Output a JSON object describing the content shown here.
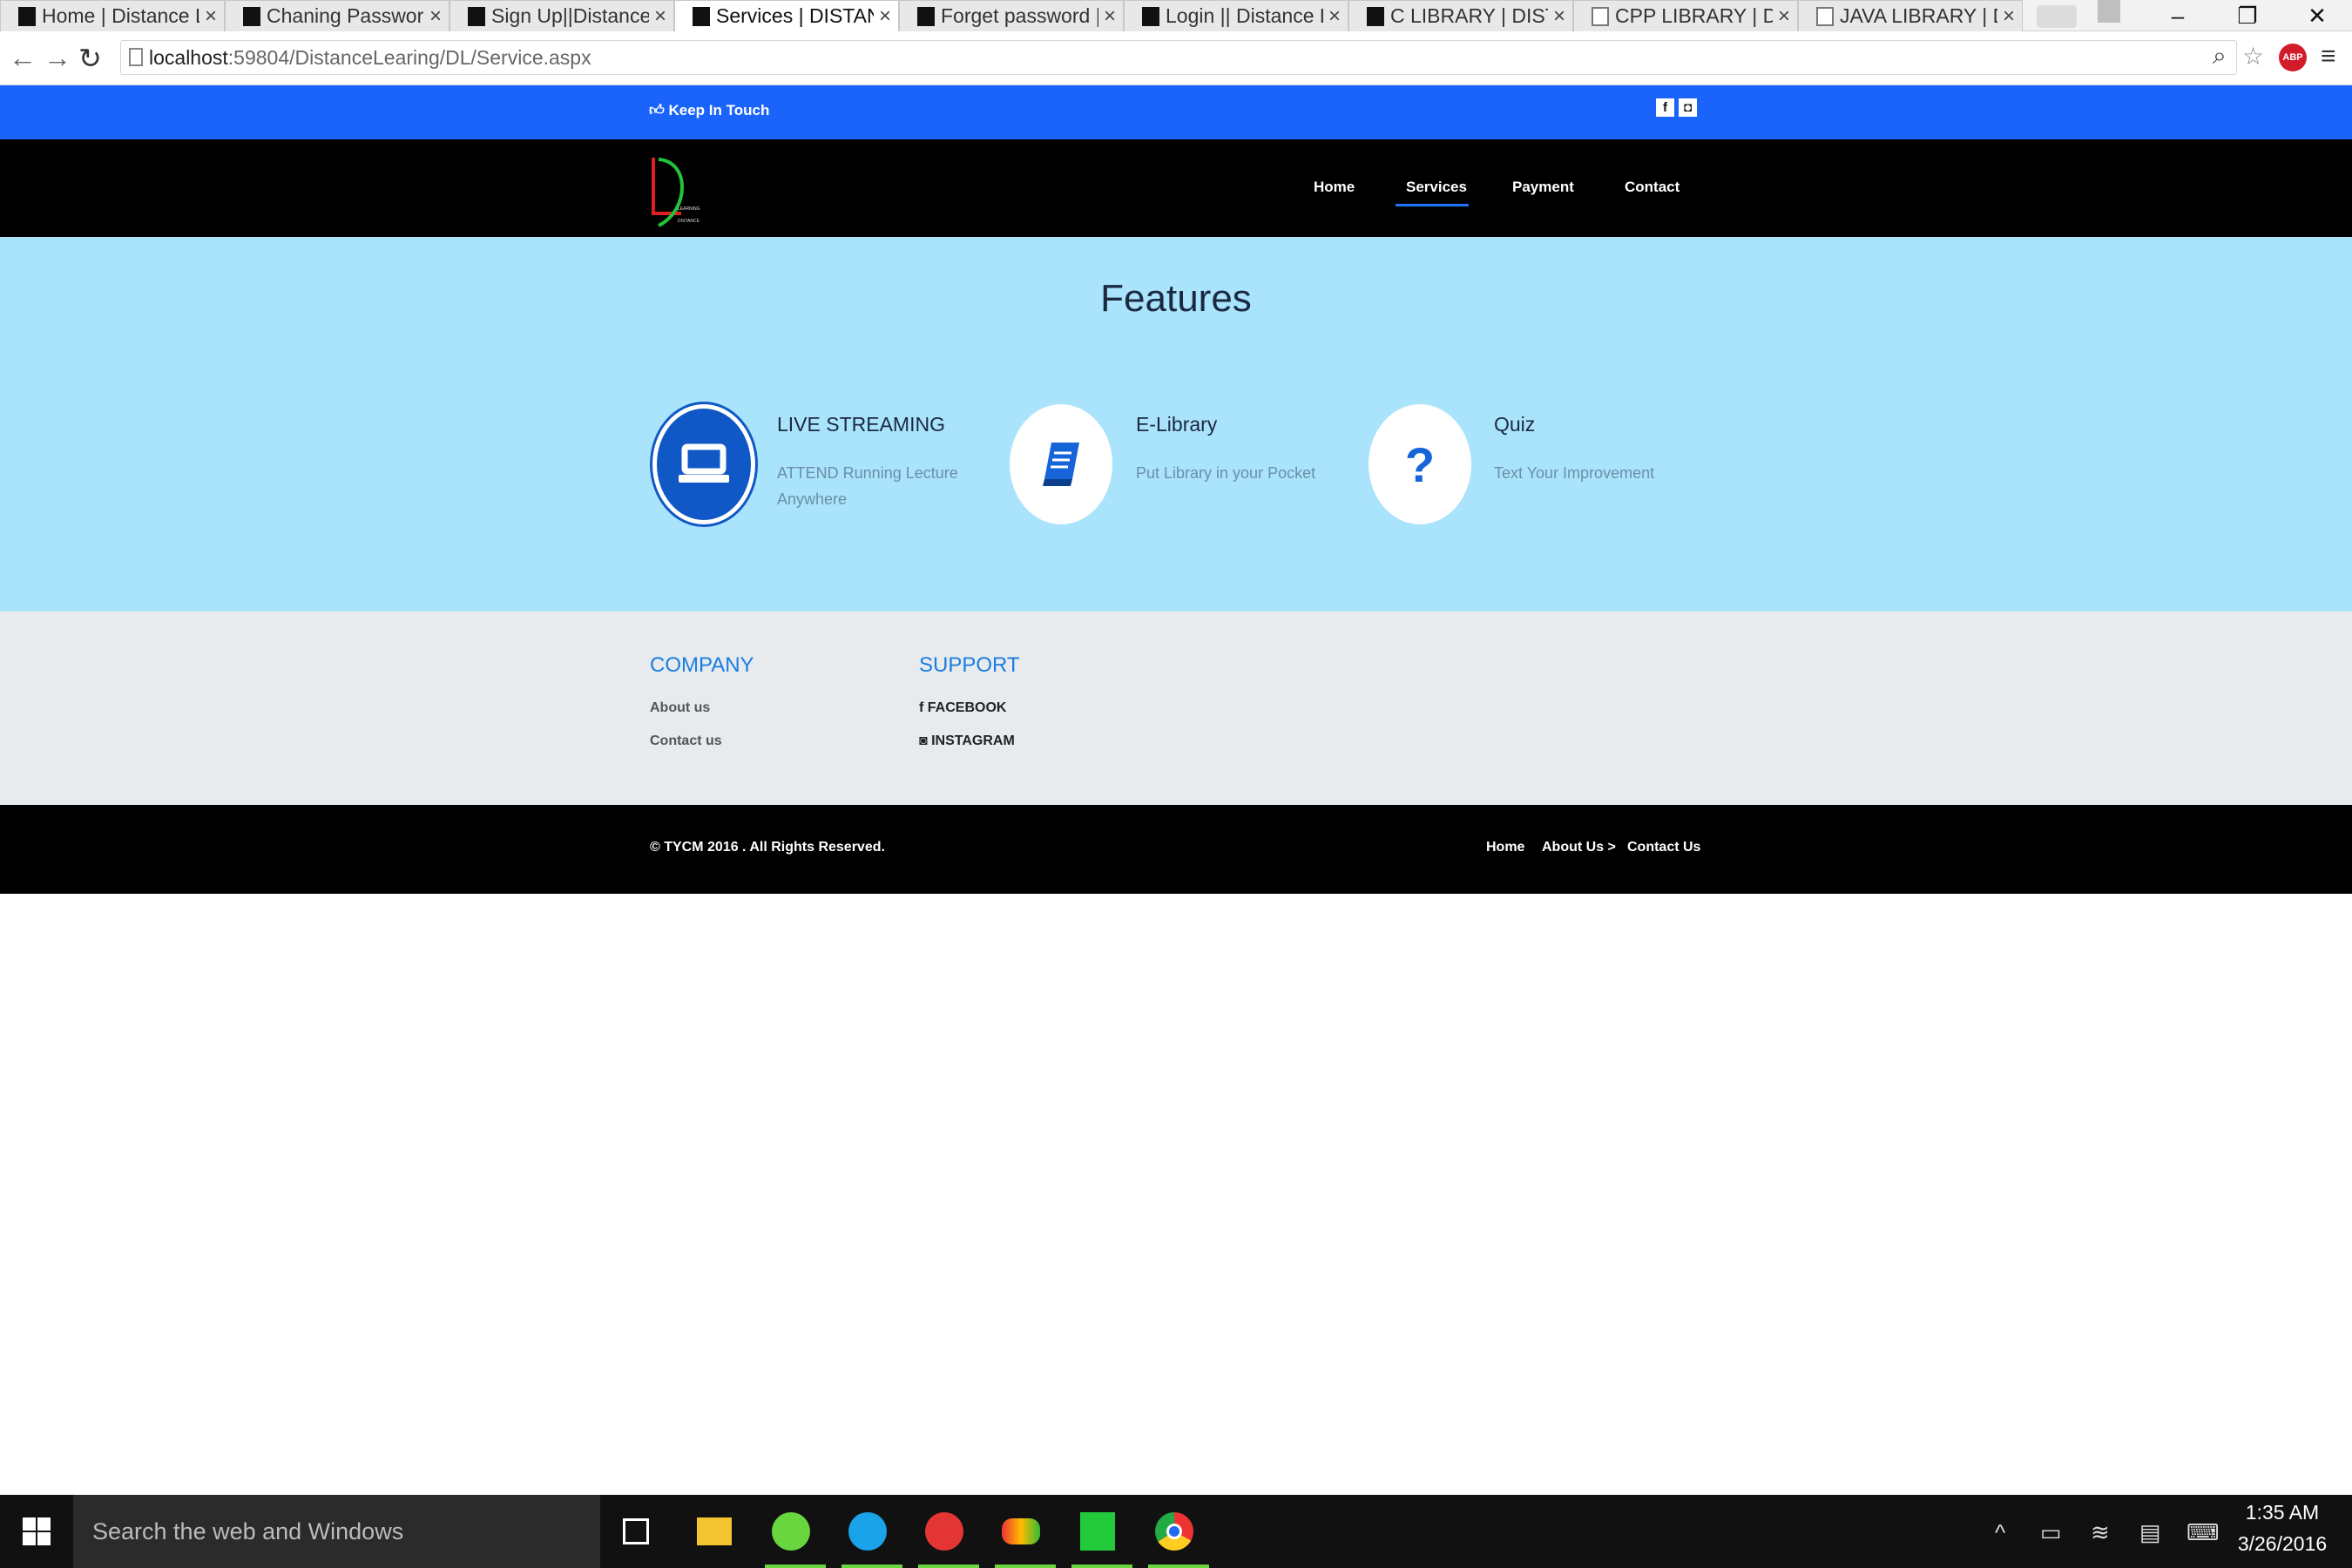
{
  "browser": {
    "tabs": [
      {
        "title": "Home | Distance Le",
        "favicon": "dl-logo-icon"
      },
      {
        "title": "Chaning Password |",
        "favicon": "dl-logo-icon"
      },
      {
        "title": "Sign Up||Distance L",
        "favicon": "dl-logo-icon"
      },
      {
        "title": "Services | DISTANC",
        "favicon": "dl-logo-icon"
      },
      {
        "title": "Forget password | D",
        "favicon": "dl-logo-icon"
      },
      {
        "title": "Login || Distance Le",
        "favicon": "dl-logo-icon"
      },
      {
        "title": "C LIBRARY | DISTA",
        "favicon": "dl-logo-icon"
      },
      {
        "title": "CPP LIBRARY | DIST",
        "favicon": "page-icon"
      },
      {
        "title": "JAVA LIBRARY | DIS",
        "favicon": "page-icon"
      }
    ],
    "active_tab": 3,
    "url_host": "localhost",
    "url_path": ":59804/DistanceLearing/DL/Service.aspx"
  },
  "site": {
    "topbar": {
      "keep_in_touch": "Keep In Touch",
      "social": [
        "f",
        "◘"
      ]
    },
    "nav": {
      "items": [
        "Home",
        "Services",
        "Payment",
        "Contact"
      ],
      "active": "Services"
    },
    "logo_small_text": "LEARNING DISTANCE",
    "features": {
      "title": "Features",
      "items": [
        {
          "title": "LIVE STREAMING",
          "desc": "ATTEND Running Lecture Anywhere",
          "icon": "laptop-icon"
        },
        {
          "title": "E-Library",
          "desc": "Put Library in your Pocket",
          "icon": "book-icon"
        },
        {
          "title": "Quiz",
          "desc": "Text Your Improvement",
          "icon": "question-icon"
        }
      ]
    },
    "footer": {
      "company_title": "COMPANY",
      "company_links": [
        "About us",
        "Contact us"
      ],
      "support_title": "SUPPORT",
      "support_links": [
        "FACEBOOK",
        "INSTAGRAM"
      ]
    },
    "bottom": {
      "copyright": "© TYCM 2016 . All Rights Reserved.",
      "links": [
        "Home",
        "About Us >",
        "Contact Us"
      ]
    }
  },
  "taskbar": {
    "search_placeholder": "Search the web and Windows",
    "time": "1:35 AM",
    "date": "3/26/2016"
  },
  "colors": {
    "blue": "#1b64fb",
    "light": "#a9e3fc",
    "accent": "#1a7de0"
  }
}
